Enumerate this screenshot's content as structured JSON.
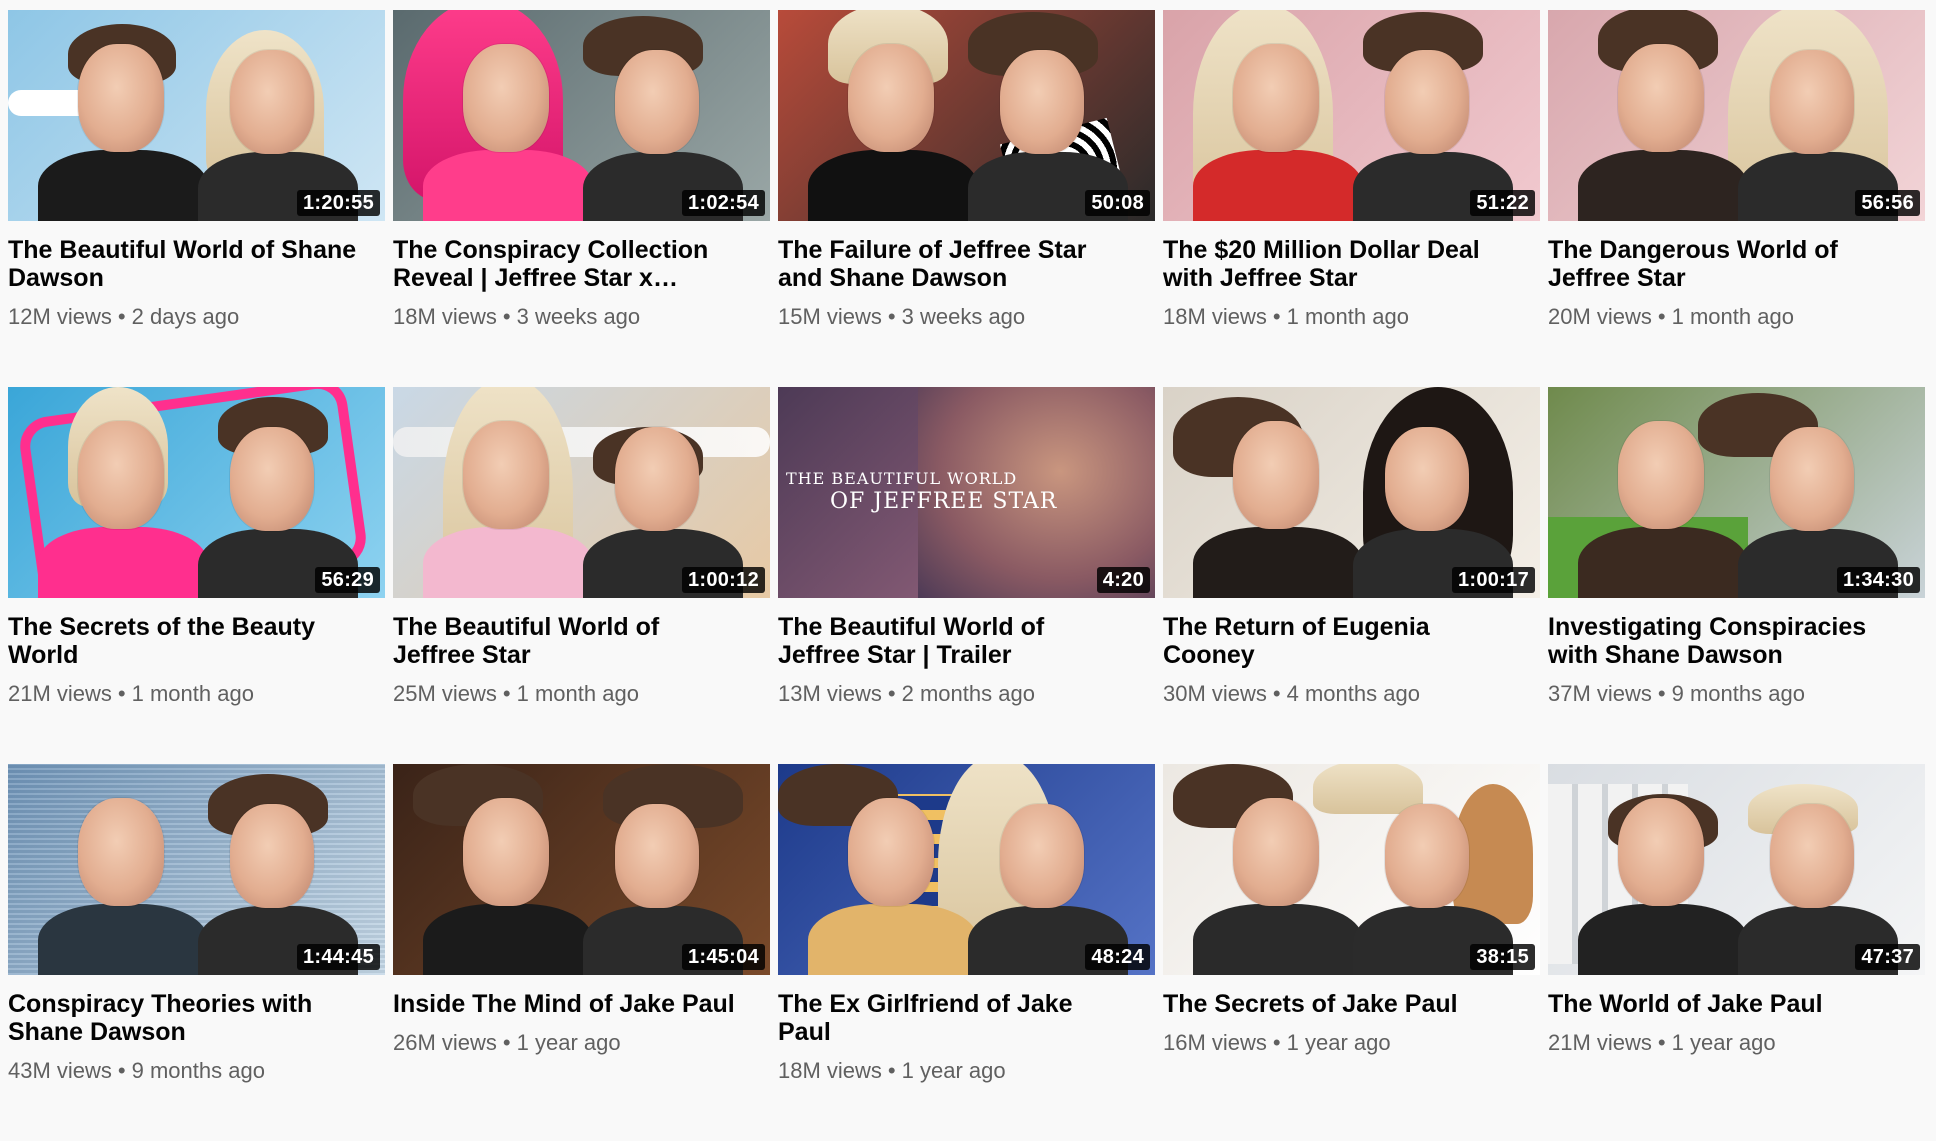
{
  "videos": [
    {
      "title": "The Beautiful World of Shane Dawson",
      "duration": "1:20:55",
      "views": "12M views",
      "age": "2 days ago",
      "bg": [
        "#8ec6e6",
        "#cfe6f4"
      ],
      "accent": "#1b1b1b",
      "scene": "plane-sky"
    },
    {
      "title": "The Conspiracy Collection Reveal | Jeffree Star x Shan…",
      "duration": "1:02:54",
      "views": "18M views",
      "age": "3 weeks ago",
      "bg": [
        "#5a6a6e",
        "#9aa7a6"
      ],
      "accent": "#ff3d8b",
      "scene": "pink-hair"
    },
    {
      "title": "The Failure of Jeffree Star and Shane Dawson",
      "duration": "50:08",
      "views": "15M views",
      "age": "3 weeks ago",
      "bg": [
        "#b84b3a",
        "#2a2a2a"
      ],
      "accent": "#111111",
      "scene": "conspiracy"
    },
    {
      "title": "The $20 Million Dollar Deal with Jeffree Star",
      "duration": "51:22",
      "views": "18M views",
      "age": "1 month ago",
      "bg": [
        "#d9a3a9",
        "#f1c9cf"
      ],
      "accent": "#d42a2a",
      "scene": "pink-room"
    },
    {
      "title": "The Dangerous World of Jeffree Star",
      "duration": "56:56",
      "views": "20M views",
      "age": "1 month ago",
      "bg": [
        "#d8a7ad",
        "#f2d4d7"
      ],
      "accent": "#2d2420",
      "scene": "pink-room2"
    },
    {
      "title": "The Secrets of the Beauty World",
      "duration": "56:29",
      "views": "21M views",
      "age": "1 month ago",
      "bg": [
        "#3aa6d8",
        "#8ed2f0"
      ],
      "accent": "#ff2f8e",
      "scene": "star"
    },
    {
      "title": "The Beautiful World of Jeffree Star",
      "duration": "1:00:12",
      "views": "25M views",
      "age": "1 month ago",
      "bg": [
        "#c9d8e6",
        "#e7c9a4"
      ],
      "accent": "#f3b8cf",
      "scene": "plane-desert"
    },
    {
      "title": "The Beautiful World of Jeffree Star | Trailer",
      "duration": "4:20",
      "views": "13M views",
      "age": "2 months ago",
      "bg": [
        "#4d3a56",
        "#a56d86"
      ],
      "accent": "#7fb9c5",
      "scene": "trailer",
      "overlay_line1": "THE BEAUTIFUL WORLD",
      "overlay_line2": "OF JEFFREE STAR"
    },
    {
      "title": "The Return of Eugenia Cooney",
      "duration": "1:00:17",
      "views": "30M views",
      "age": "4 months ago",
      "bg": [
        "#d9d2c7",
        "#f4efe7"
      ],
      "accent": "#221c19",
      "scene": "eugenia"
    },
    {
      "title": "Investigating Conspiracies with Shane Dawson",
      "duration": "1:34:30",
      "views": "37M views",
      "age": "9 months ago",
      "bg": [
        "#6f8a4c",
        "#c9d3d8"
      ],
      "accent": "#3b2a20",
      "scene": "dust"
    },
    {
      "title": "Conspiracy Theories with Shane Dawson",
      "duration": "1:44:45",
      "views": "43M views",
      "age": "9 months ago",
      "bg": [
        "#6f94b8",
        "#c4d7e6"
      ],
      "accent": "#2a3640",
      "scene": "glitch"
    },
    {
      "title": "Inside The Mind of Jake Paul",
      "duration": "1:45:04",
      "views": "26M views",
      "age": "1 year ago",
      "bg": [
        "#3a2318",
        "#7a4a2a"
      ],
      "accent": "#1b1b1b",
      "scene": "dark-room"
    },
    {
      "title": "The Ex Girlfriend of Jake Paul",
      "duration": "48:24",
      "views": "18M views",
      "age": "1 year ago",
      "bg": [
        "#1d3a8a",
        "#5573c6"
      ],
      "accent": "#e2b46a",
      "scene": "night-house"
    },
    {
      "title": "The Secrets of Jake Paul",
      "duration": "38:15",
      "views": "16M views",
      "age": "1 year ago",
      "bg": [
        "#ece8e2",
        "#ffffff"
      ],
      "accent": "#2a2a2a",
      "scene": "white-room"
    },
    {
      "title": "The World of Jake Paul",
      "duration": "47:37",
      "views": "21M views",
      "age": "1 year ago",
      "bg": [
        "#d9dde2",
        "#f4f5f6"
      ],
      "accent": "#222222",
      "scene": "mansion"
    }
  ]
}
